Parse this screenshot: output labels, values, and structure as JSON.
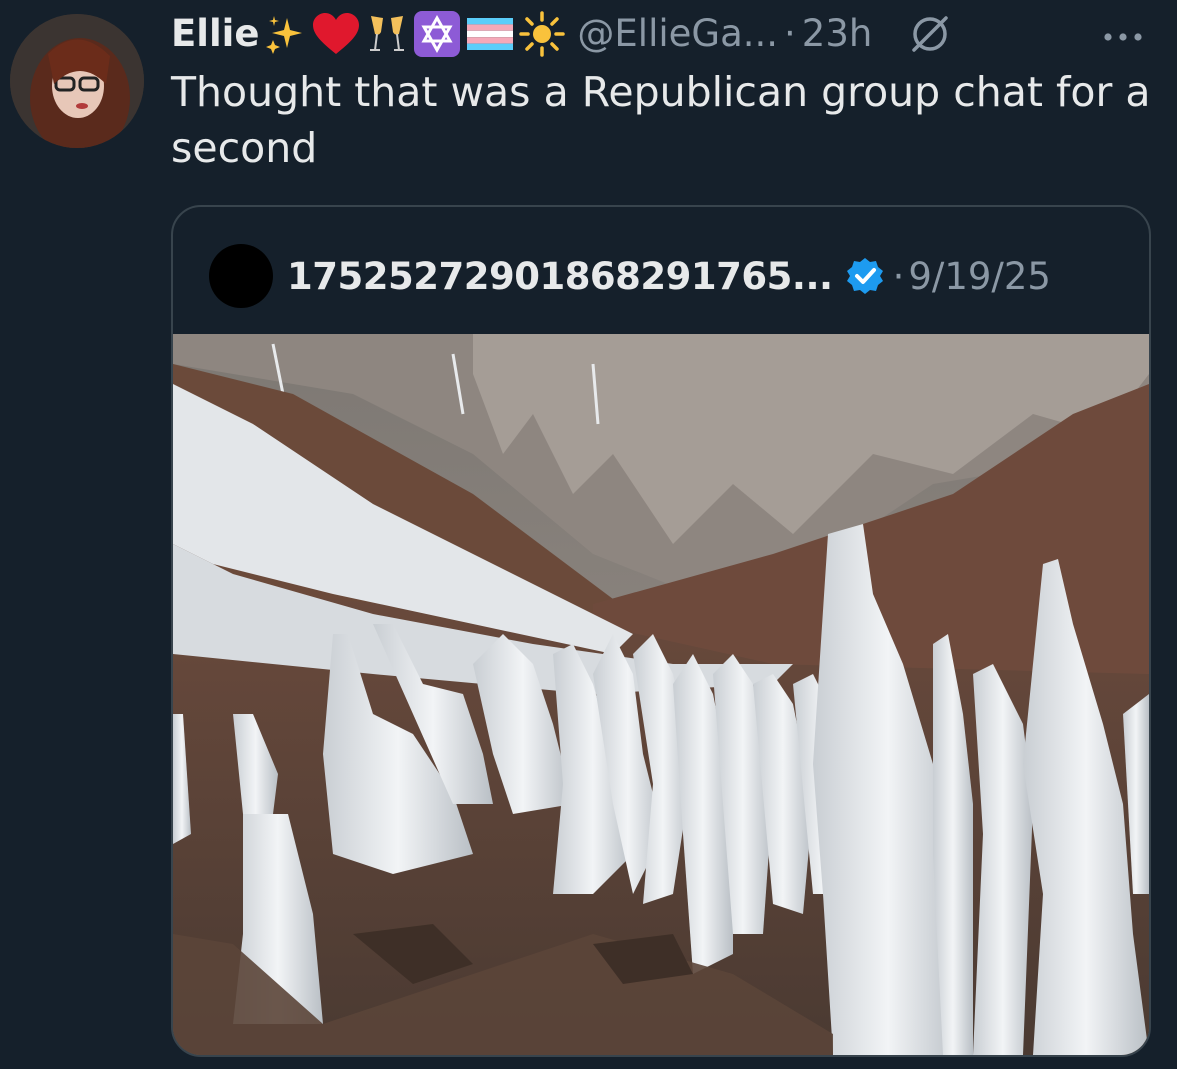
{
  "tweet": {
    "author_name": "Ellie",
    "handle": "@EllieGa...",
    "separator": "·",
    "time": "23h",
    "text": "Thought that was a Republican group chat for a second",
    "name_emojis": [
      "sparkles",
      "red-heart",
      "clinking-glasses",
      "star-of-david",
      "transgender-flag",
      "sun"
    ]
  },
  "quote": {
    "author_name": "17525272901868291765...",
    "verified": true,
    "separator": "·",
    "date": "9/19/25",
    "media_description": "penitentes-ice-spikes-photo"
  },
  "colors": {
    "background": "#15202b",
    "text_primary": "#e7e9ea",
    "text_secondary": "#8b98a5",
    "border": "#38444d",
    "verified_blue": "#1d9bf0"
  },
  "icons": {
    "grok": "grok-icon",
    "more": "more-dots-icon",
    "verified": "verified-badge-icon"
  }
}
